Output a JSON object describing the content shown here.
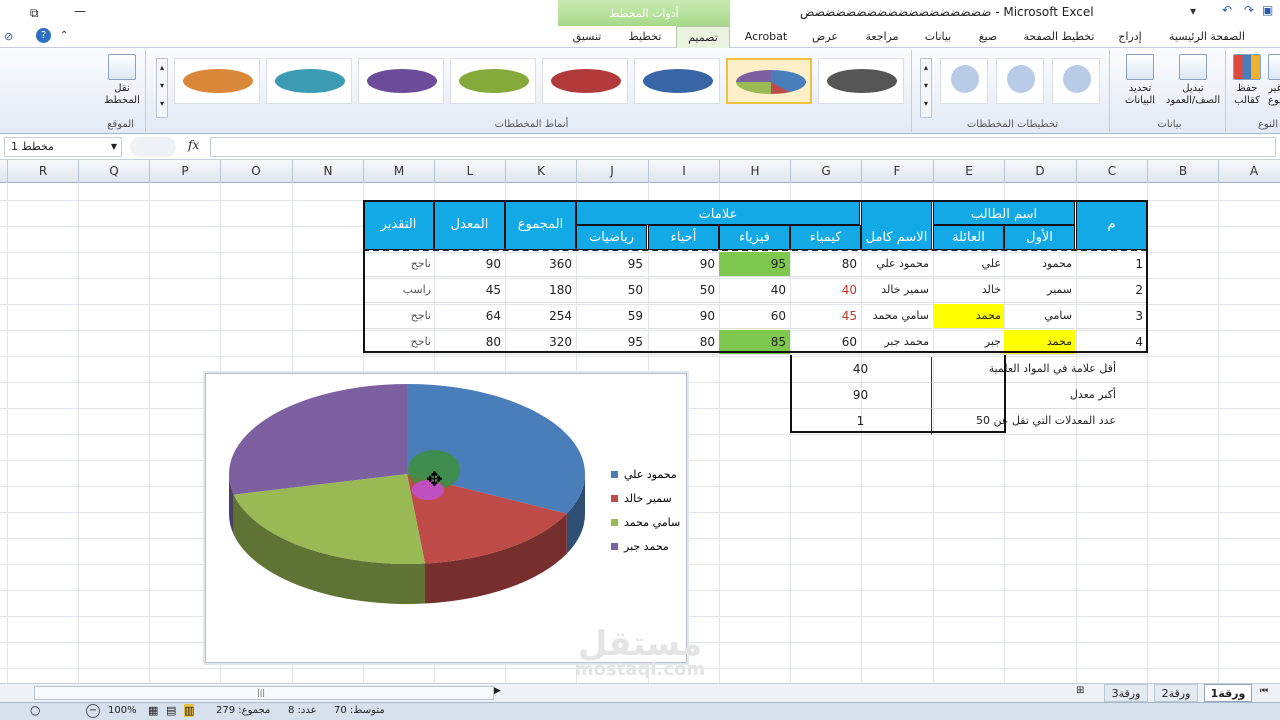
{
  "window": {
    "title": "ضضضضضضضضضضضضضضضضضض - Microsoft Excel",
    "context_tools": "أدوات المخطط"
  },
  "ribbon_tabs": [
    "الصفحة الرئيسية",
    "إدراج",
    "تخطيط الصفحة",
    "صيغ",
    "بيانات",
    "مراجعة",
    "عرض",
    "Acrobat",
    "تصميم",
    "تخطيط",
    "تنسيق"
  ],
  "groups": {
    "styles": "أنماط المخططات",
    "layouts": "تخطيطات المخططات",
    "data": "بيانات",
    "location": "الموقع",
    "type": "النوع"
  },
  "buttons": {
    "move_chart": "نقل\nالمخطط",
    "select_data": "تحديد\nالبيانات",
    "switch": "تبديل\nالصف/العمود",
    "save_template": "حفظ\nكقالب",
    "change_type": "غير\nالنوع"
  },
  "formula_bar": {
    "name_box": "مخطط 1",
    "fx": "fx",
    "value": ""
  },
  "columns": [
    "A",
    "B",
    "C",
    "D",
    "E",
    "F",
    "G",
    "H",
    "I",
    "J",
    "K",
    "L",
    "M",
    "N",
    "O",
    "P",
    "Q",
    "R"
  ],
  "table": {
    "h_id": "م",
    "h_name": "اسم الطالب",
    "h_first": "الأول",
    "h_last": "العائلة",
    "h_full": "الاسم كامل",
    "h_marks": "علامات",
    "h_chem": "كيمياء",
    "h_phys": "فيزياء",
    "h_bio": "أحياء",
    "h_math": "رياضيات",
    "h_total": "المجموع",
    "h_avg": "المعدل",
    "h_grade": "التقدير",
    "rows": [
      {
        "id": "1",
        "first": "محمود",
        "last": "علي",
        "full": "محمود علي",
        "chem": "80",
        "phys": "95",
        "bio": "90",
        "math": "95",
        "total": "360",
        "avg": "90",
        "grade": "ناجح"
      },
      {
        "id": "2",
        "first": "سمير",
        "last": "خالد",
        "full": "سمير خالد",
        "chem": "40",
        "phys": "40",
        "bio": "50",
        "math": "50",
        "total": "180",
        "avg": "45",
        "grade": "راسب"
      },
      {
        "id": "3",
        "first": "سامي",
        "last": "محمد",
        "full": "سامي محمد",
        "chem": "45",
        "phys": "60",
        "bio": "90",
        "math": "59",
        "total": "254",
        "avg": "64",
        "grade": "ناجح"
      },
      {
        "id": "4",
        "first": "محمد",
        "last": "جبر",
        "full": "محمد جبر",
        "chem": "60",
        "phys": "85",
        "bio": "80",
        "math": "95",
        "total": "320",
        "avg": "80",
        "grade": "ناجح"
      }
    ],
    "summary": [
      {
        "label": "أقل علامة في المواد العلمية",
        "value": "40"
      },
      {
        "label": "أكبر معدل",
        "value": "90"
      },
      {
        "label": "عدد المعدلات التي تقل عن 50",
        "value": "1"
      }
    ]
  },
  "chart_data": {
    "type": "pie",
    "categories": [
      "محمود علي",
      "سمير خالد",
      "سامي محمد",
      "محمد جبر"
    ],
    "values": [
      90,
      45,
      64,
      80
    ],
    "colors": [
      "#4a7ebb",
      "#be4b48",
      "#98b954",
      "#7d60a0"
    ],
    "title": "",
    "legend": "right"
  },
  "watermark": {
    "brand": "مستقل",
    "url": "mostaql.com"
  },
  "sheet_tabs": [
    "ورقة1",
    "ورقة2",
    "ورقة3"
  ],
  "status": {
    "average": "متوسط: 70",
    "count": "عدد: 8",
    "sum": "مجموع: 279",
    "zoom": "100%"
  }
}
